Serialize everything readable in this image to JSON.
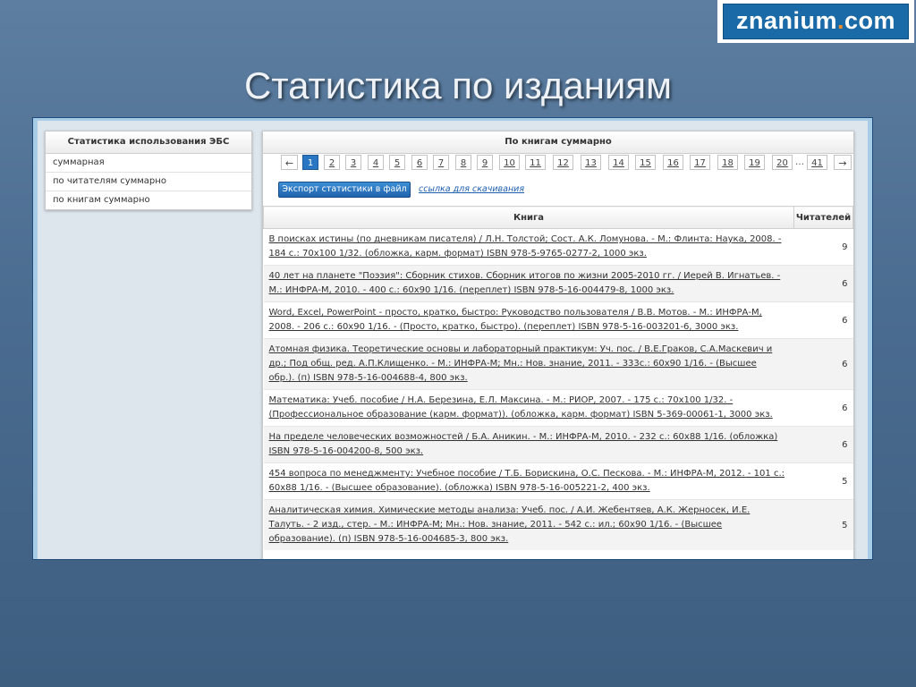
{
  "logo": {
    "text_a": "znanium",
    "text_dot": ".",
    "text_b": "com"
  },
  "slide_title": "Статистика по изданиям",
  "left_panel": {
    "header": "Статистика использования ЭБС",
    "items": [
      "суммарная",
      "по читателям суммарно",
      "по книгам суммарно"
    ]
  },
  "right_panel": {
    "header": "По книгам суммарно",
    "pagination": {
      "prev": "←",
      "pages": [
        "1",
        "2",
        "3",
        "4",
        "5",
        "6",
        "7",
        "8",
        "9",
        "10",
        "11",
        "12",
        "13",
        "14",
        "15",
        "16",
        "17",
        "18",
        "19",
        "20"
      ],
      "active": "1",
      "ellipsis": "…",
      "last": "41",
      "next": "→"
    },
    "export_button": "Экспорт статистики в файл",
    "download_link": "ссылка для скачивания",
    "table": {
      "columns": [
        "Книга",
        "Читателей"
      ],
      "rows": [
        {
          "book": "В поисках истины (по дневникам писателя) / Л.Н. Толстой; Сост. А.К. Ломунова. - М.: Флинта: Наука, 2008. - 184 с.: 70x100 1/32. (обложка, карм. формат) ISBN 978-5-9765-0277-2, 1000 экз.",
          "readers": "9"
        },
        {
          "book": "40 лет на планете \"Поэзия\": Сборник стихов. Сборник итогов по жизни 2005-2010 гг. / Иерей В. Игнатьев. - М.: ИНФРА-М, 2010. - 400 с.: 60x90 1/16. (переплет) ISBN 978-5-16-004479-8, 1000 экз.",
          "readers": "6"
        },
        {
          "book": "Word, Excel, PowerPoint - просто, кратко, быстро: Руководство пользователя / В.В. Мотов. - М.: ИНФРА-М, 2008. - 206 с.: 60x90 1/16. - (Просто, кратко, быстро). (переплет) ISBN 978-5-16-003201-6, 3000 экз.",
          "readers": "6"
        },
        {
          "book": "Атомная физика. Теоретические основы и лабораторный практикум: Уч. пос. / В.Е.Граков, С.А.Маскевич и др.; Под общ. ред. А.П.Клищенко. - М.: ИНФРА-М; Мн.: Нов. знание, 2011. - 333с.: 60x90 1/16. - (Высшее обр.). (п) ISBN 978-5-16-004688-4, 800 экз.",
          "readers": "6"
        },
        {
          "book": "Математика: Учеб. пособие / Н.А. Березина, Е.Л. Максина. - М.: РИОР, 2007. - 175 с.: 70x100 1/32. - (Профессиональное образование (карм. формат)). (обложка, карм. формат) ISBN 5-369-00061-1, 3000 экз.",
          "readers": "6"
        },
        {
          "book": "На пределе человеческих возможностей / Б.А. Аникин. - М.: ИНФРА-М, 2010. - 232 с.: 60x88 1/16. (обложка) ISBN 978-5-16-004200-8, 500 экз.",
          "readers": "6"
        },
        {
          "book": "454 вопроса по менеджменту: Учебное пособие / Т.Б. Борискина, О.С. Пескова. - М.: ИНФРА-М, 2012. - 101 с.: 60x88 1/16. - (Высшее образование). (обложка) ISBN 978-5-16-005221-2, 400 экз.",
          "readers": "5"
        },
        {
          "book": "Аналитическая химия. Химические методы анализа: Учеб. пос. / А.И. Жебентяев, А.К. Жерносек, И.Е. Талуть. - 2 изд., стер. - М.: ИНФРА-М; Мн.: Нов. знание, 2011. - 542 с.: ил.; 60x90 1/16. - (Высшее образование). (п) ISBN 978-5-16-004685-3, 800 экз.",
          "readers": "5"
        }
      ]
    }
  }
}
